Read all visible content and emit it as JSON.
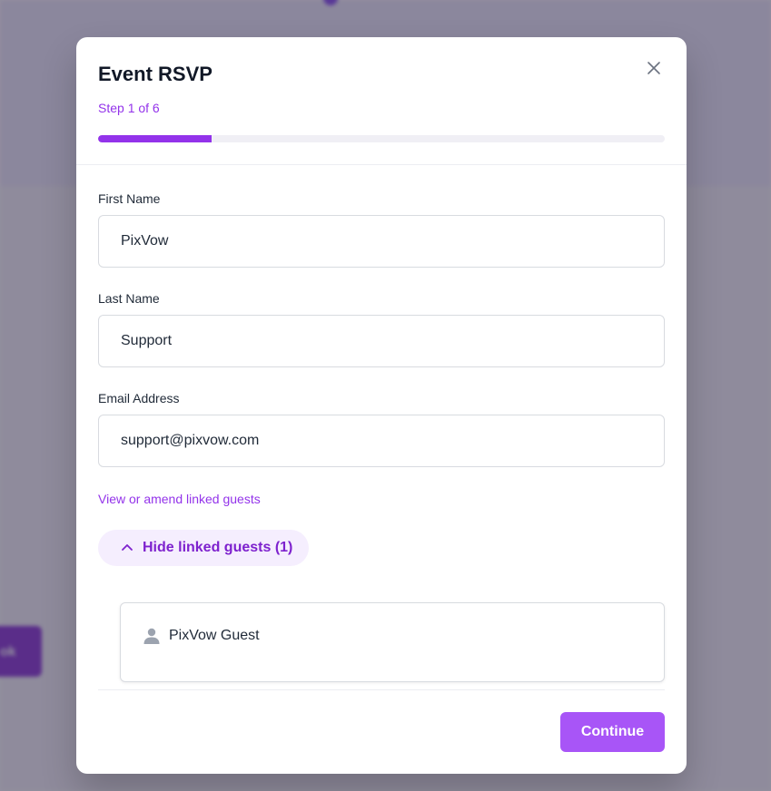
{
  "modal": {
    "title": "Event RSVP",
    "step_text": "Step 1 of 6",
    "progress_fraction": 0.2
  },
  "form": {
    "first_name": {
      "label": "First Name",
      "value": "PixVow"
    },
    "last_name": {
      "label": "Last Name",
      "value": "Support"
    },
    "email": {
      "label": "Email Address",
      "value": "support@pixvow.com"
    }
  },
  "linked_guests": {
    "link_text": "View or amend linked guests",
    "toggle_label": "Hide linked guests (1)",
    "guests": [
      {
        "name": "PixVow Guest"
      }
    ]
  },
  "footer": {
    "continue_label": "Continue"
  },
  "colors": {
    "accent": "#9333ea",
    "button": "#a855f7"
  }
}
